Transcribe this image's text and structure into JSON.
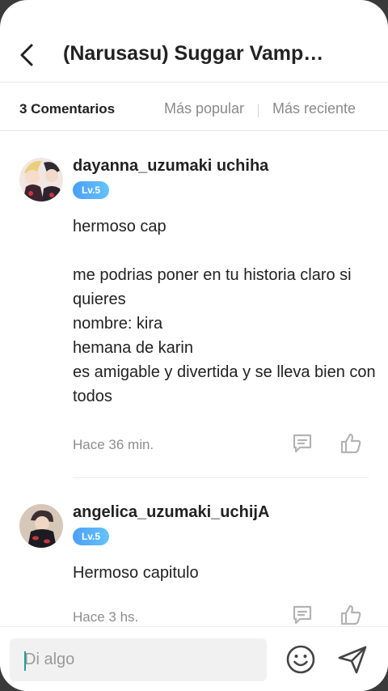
{
  "header": {
    "title": "(Narusasu) Suggar Vamp…",
    "back_icon": "chevron-left-icon"
  },
  "tabs": {
    "count_label": "3 Comentarios",
    "popular_label": "Más popular",
    "recent_label": "Más reciente"
  },
  "comments": [
    {
      "username": "dayanna_uzumaki uchiha",
      "level": "Lv.5",
      "text": "hermoso cap\n\nme podrias poner en tu historia claro si quieres\nnombre: kira\nhemana de karin\nes amigable y divertida y se lleva bien con todos",
      "time": "Hace 36 min."
    },
    {
      "username": "angelica_uzumaki_uchijA",
      "level": "Lv.5",
      "text": "Hermoso capitulo",
      "time": "Hace 3 hs."
    }
  ],
  "composer": {
    "placeholder": "Di algo",
    "emoji_icon": "smiley-icon",
    "send_icon": "send-icon"
  },
  "colors": {
    "level_badge": "#4a9ff5",
    "caret": "#1aa39a",
    "text": "#222222",
    "muted": "#8d8d8d"
  }
}
